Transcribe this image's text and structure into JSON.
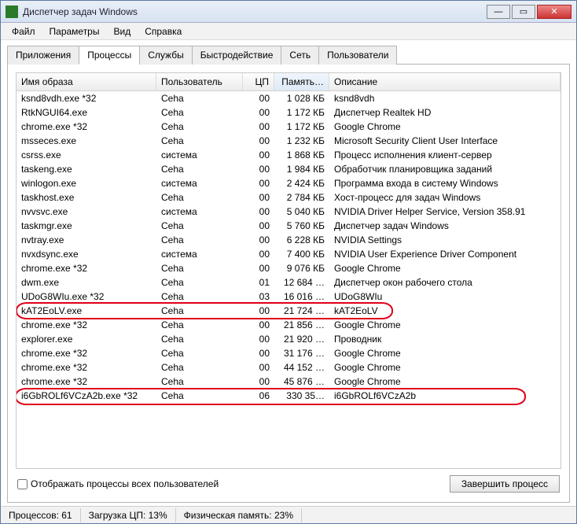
{
  "window": {
    "title": "Диспетчер задач Windows"
  },
  "menu": {
    "file": "Файл",
    "options": "Параметры",
    "view": "Вид",
    "help": "Справка"
  },
  "tabs": {
    "apps": "Приложения",
    "processes": "Процессы",
    "services": "Службы",
    "performance": "Быстродействие",
    "network": "Сеть",
    "users": "Пользователи"
  },
  "columns": {
    "image": "Имя образа",
    "user": "Пользователь",
    "cpu": "ЦП",
    "mem": "Память…",
    "desc": "Описание"
  },
  "rows": [
    {
      "name": "ksnd8vdh.exe *32",
      "user": "Ceha",
      "cpu": "00",
      "mem": "1 028 КБ",
      "desc": "ksnd8vdh"
    },
    {
      "name": "RtkNGUI64.exe",
      "user": "Ceha",
      "cpu": "00",
      "mem": "1 172 КБ",
      "desc": "Диспетчер Realtek HD"
    },
    {
      "name": "chrome.exe *32",
      "user": "Ceha",
      "cpu": "00",
      "mem": "1 172 КБ",
      "desc": "Google Chrome"
    },
    {
      "name": "msseces.exe",
      "user": "Ceha",
      "cpu": "00",
      "mem": "1 232 КБ",
      "desc": "Microsoft Security Client User Interface"
    },
    {
      "name": "csrss.exe",
      "user": "система",
      "cpu": "00",
      "mem": "1 868 КБ",
      "desc": "Процесс исполнения клиент-сервер"
    },
    {
      "name": "taskeng.exe",
      "user": "Ceha",
      "cpu": "00",
      "mem": "1 984 КБ",
      "desc": "Обработчик планировщика заданий"
    },
    {
      "name": "winlogon.exe",
      "user": "система",
      "cpu": "00",
      "mem": "2 424 КБ",
      "desc": "Программа входа в систему Windows"
    },
    {
      "name": "taskhost.exe",
      "user": "Ceha",
      "cpu": "00",
      "mem": "2 784 КБ",
      "desc": "Хост-процесс для задач Windows"
    },
    {
      "name": "nvvsvc.exe",
      "user": "система",
      "cpu": "00",
      "mem": "5 040 КБ",
      "desc": "NVIDIA Driver Helper Service, Version 358.91"
    },
    {
      "name": "taskmgr.exe",
      "user": "Ceha",
      "cpu": "00",
      "mem": "5 760 КБ",
      "desc": "Диспетчер задач Windows"
    },
    {
      "name": "nvtray.exe",
      "user": "Ceha",
      "cpu": "00",
      "mem": "6 228 КБ",
      "desc": "NVIDIA Settings"
    },
    {
      "name": "nvxdsync.exe",
      "user": "система",
      "cpu": "00",
      "mem": "7 400 КБ",
      "desc": "NVIDIA User Experience Driver Component"
    },
    {
      "name": "chrome.exe *32",
      "user": "Ceha",
      "cpu": "00",
      "mem": "9 076 КБ",
      "desc": "Google Chrome"
    },
    {
      "name": "dwm.exe",
      "user": "Ceha",
      "cpu": "01",
      "mem": "12 684 …",
      "desc": "Диспетчер окон рабочего стола"
    },
    {
      "name": "UDoG8WIu.exe *32",
      "user": "Ceha",
      "cpu": "03",
      "mem": "16 016 …",
      "desc": "UDoG8WIu"
    },
    {
      "name": "kAT2EoLV.exe",
      "user": "Ceha",
      "cpu": "00",
      "mem": "21 724 …",
      "desc": "kAT2EoLV"
    },
    {
      "name": "chrome.exe *32",
      "user": "Ceha",
      "cpu": "00",
      "mem": "21 856 …",
      "desc": "Google Chrome"
    },
    {
      "name": "explorer.exe",
      "user": "Ceha",
      "cpu": "00",
      "mem": "21 920 …",
      "desc": "Проводник"
    },
    {
      "name": "chrome.exe *32",
      "user": "Ceha",
      "cpu": "00",
      "mem": "31 176 …",
      "desc": "Google Chrome"
    },
    {
      "name": "chrome.exe *32",
      "user": "Ceha",
      "cpu": "00",
      "mem": "44 152 …",
      "desc": "Google Chrome"
    },
    {
      "name": "chrome.exe *32",
      "user": "Ceha",
      "cpu": "00",
      "mem": "45 876 …",
      "desc": "Google Chrome"
    },
    {
      "name": "i6GbROLf6VCzA2b.exe *32",
      "user": "Ceha",
      "cpu": "06",
      "mem": "330 35…",
      "desc": "i6GbROLf6VCzA2b"
    }
  ],
  "footer": {
    "show_all": "Отображать процессы всех пользователей",
    "end_process": "Завершить процесс"
  },
  "status": {
    "processes": "Процессов: 61",
    "cpu": "Загрузка ЦП: 13%",
    "mem": "Физическая память: 23%"
  }
}
